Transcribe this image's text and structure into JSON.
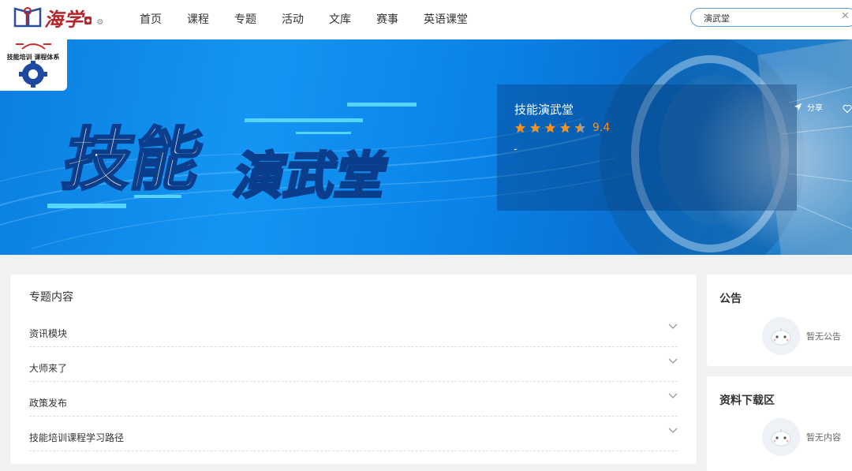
{
  "header": {
    "logo_text": "海学",
    "logo_badge": "",
    "nav": [
      "首页",
      "课程",
      "专题",
      "活动",
      "文库",
      "赛事",
      "英语课堂"
    ],
    "search_value": "演武堂",
    "search_clear": "✕"
  },
  "banner": {
    "title_main": "技能",
    "title_sub": "演武堂",
    "corner_logo_text": "技能培训 课程体系",
    "course_title": "技能演武堂",
    "rating": "9.4",
    "stars_value": 4.5,
    "subtitle": "-",
    "share_label": "分享"
  },
  "main": {
    "title": "专题内容",
    "sections": [
      "资讯模块",
      "大师来了",
      "政策发布",
      "技能培训课程学习路径"
    ]
  },
  "sidebar": {
    "notice_title": "公告",
    "notice_empty": "暂无公告",
    "download_title": "资料下载区",
    "download_empty": "暂无内容"
  },
  "colors": {
    "accent": "#1495f3",
    "brand": "#b3262b",
    "star": "#f7921e"
  }
}
